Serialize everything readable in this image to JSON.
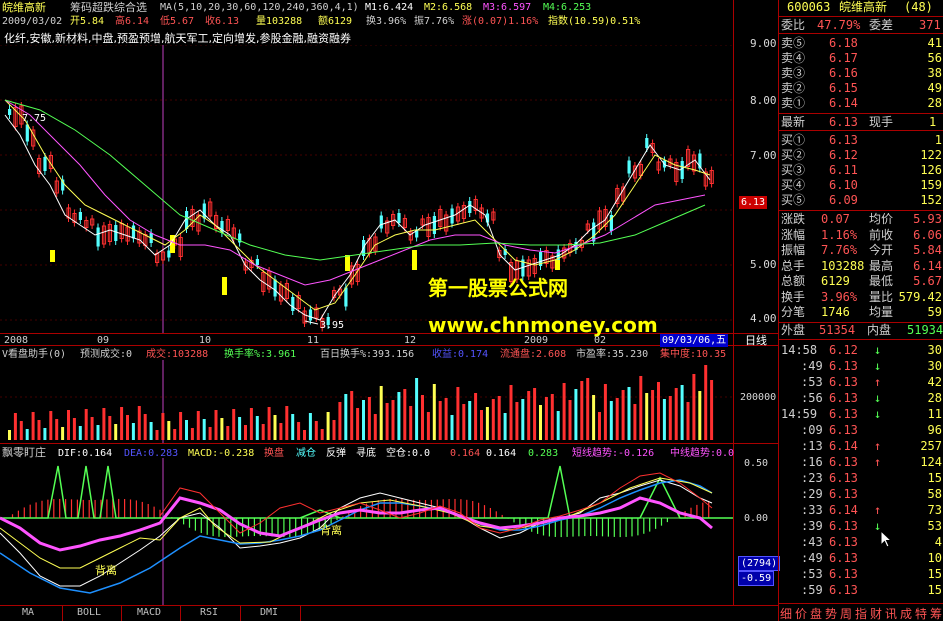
{
  "header": {
    "stock_name": "皖维高新",
    "indicator_title": "筹码超跌综合选",
    "ma_params": "MA(5,10,20,30,60,120,240,360,4,1)",
    "m1": "M1:6.424",
    "m2": "M2:6.568",
    "m3": "M3:6.597",
    "m4": "M4:6.253",
    "date": "2009/03/02",
    "open": "开5.84",
    "high": "高6.14",
    "low": "低5.67",
    "close": "收6.13",
    "volume": "量103288",
    "amount": "额6129",
    "turnover": "换3.96%",
    "amplitude": "振7.76%",
    "change": "涨(0.07)1.16%",
    "index": "指数(10.59)0.51%",
    "concepts": "化纤,安徽,新材料,中盘,预盈预增,航天军工,定向增发,参股金融,融资融券"
  },
  "watermark": {
    "line1": "第一股票公式网",
    "line2": "www.chnmoney.com"
  },
  "price_axis": [
    "9.00",
    "8.00",
    "7.00",
    "6.13",
    "5.00",
    "4.00"
  ],
  "chart_labels": {
    "peak": "7.75",
    "trough": "3.95"
  },
  "date_axis": [
    "2008",
    "09",
    "10",
    "11",
    "12",
    "2009",
    "02"
  ],
  "date_badge": "09/03/06,五",
  "period": "日线",
  "volume_panel": {
    "title": "V看盘助手(0)",
    "forecast": "预测成交:0",
    "volume": "成交:103288",
    "turnover": "换手率%:3.961",
    "hundred_turnover": "百日换手%:393.156",
    "profit": "收益:0.174",
    "circulation": "流通盘:2.608",
    "pe": "市盈率:35.230",
    "concentration": "集中度:10.35",
    "axis": "200000"
  },
  "macd_panel": {
    "title": "飘零盯庄",
    "dif": "DIF:0.164",
    "dea": "DEA:0.283",
    "macd": "MACD:-0.238",
    "swap": "换盘",
    "reduce": "减仓",
    "rebound": "反弹",
    "bottom": "寻底",
    "empty": "空仓:0.0",
    "v1": "0.164",
    "v2": "0.164",
    "v3": "0.283",
    "short_trend": "短线趋势:-0.126",
    "mid_trend": "中线趋势:0.0",
    "axis_top": "0.50",
    "axis_mid": "0.00",
    "axis_bot": "-0.50",
    "label1": "背离",
    "label2": "背离",
    "box1": "(2794)",
    "box2": "-0.59"
  },
  "bottom_tabs": [
    "MA",
    "BOLL",
    "MACD",
    "RSI",
    "DMI"
  ],
  "quote": {
    "code": "600063",
    "name": "皖维高新",
    "count": "(48)",
    "weibi_label": "委比",
    "weibi": "47.79%",
    "weicha_label": "委差",
    "weicha": "371",
    "asks": [
      {
        "label": "卖⑤",
        "price": "6.18",
        "vol": "41"
      },
      {
        "label": "卖④",
        "price": "6.17",
        "vol": "56"
      },
      {
        "label": "卖③",
        "price": "6.16",
        "vol": "38"
      },
      {
        "label": "卖②",
        "price": "6.15",
        "vol": "49"
      },
      {
        "label": "卖①",
        "price": "6.14",
        "vol": "28"
      }
    ],
    "last_label": "最新",
    "last": "6.13",
    "cur_label": "现手",
    "cur": "1",
    "bids": [
      {
        "label": "买①",
        "price": "6.13",
        "vol": "1"
      },
      {
        "label": "买②",
        "price": "6.12",
        "vol": "122"
      },
      {
        "label": "买③",
        "price": "6.11",
        "vol": "126"
      },
      {
        "label": "买④",
        "price": "6.10",
        "vol": "159"
      },
      {
        "label": "买⑤",
        "price": "6.09",
        "vol": "152"
      }
    ],
    "stats": [
      {
        "l1": "涨跌",
        "v1": "0.07",
        "l2": "均价",
        "v2": "5.93"
      },
      {
        "l1": "涨幅",
        "v1": "1.16%",
        "l2": "前收",
        "v2": "6.06"
      },
      {
        "l1": "振幅",
        "v1": "7.76%",
        "l2": "今开",
        "v2": "5.84"
      },
      {
        "l1": "总手",
        "v1": "103288",
        "l2": "最高",
        "v2": "6.14"
      },
      {
        "l1": "总额",
        "v1": "6129",
        "l2": "最低",
        "v2": "5.67"
      },
      {
        "l1": "换手",
        "v1": "3.96%",
        "l2": "量比",
        "v2": "579.42"
      },
      {
        "l1": "分笔",
        "v1": "1746",
        "l2": "均量",
        "v2": "59"
      }
    ],
    "outer_label": "外盘",
    "outer": "51354",
    "inner_label": "内盘",
    "inner": "51934",
    "ticks": [
      {
        "t": "14:58",
        "p": "6.12",
        "a": "↓",
        "v": "30"
      },
      {
        "t": ":49",
        "p": "6.13",
        "a": "↓",
        "v": "30"
      },
      {
        "t": ":53",
        "p": "6.13",
        "a": "↑",
        "v": "42"
      },
      {
        "t": ":56",
        "p": "6.13",
        "a": "↓",
        "v": "28"
      },
      {
        "t": "14:59",
        "p": "6.13",
        "a": "↓",
        "v": "11"
      },
      {
        "t": ":09",
        "p": "6.13",
        "a": "",
        "v": "96"
      },
      {
        "t": ":13",
        "p": "6.14",
        "a": "↑",
        "v": "257"
      },
      {
        "t": ":16",
        "p": "6.13",
        "a": "↑",
        "v": "124"
      },
      {
        "t": ":23",
        "p": "6.13",
        "a": "",
        "v": "15"
      },
      {
        "t": ":29",
        "p": "6.13",
        "a": "",
        "v": "58"
      },
      {
        "t": ":33",
        "p": "6.14",
        "a": "↑",
        "v": "73"
      },
      {
        "t": ":39",
        "p": "6.13",
        "a": "↓",
        "v": "53"
      },
      {
        "t": ":43",
        "p": "6.13",
        "a": "",
        "v": "4"
      },
      {
        "t": ":49",
        "p": "6.13",
        "a": "",
        "v": "10"
      },
      {
        "t": ":53",
        "p": "6.13",
        "a": "",
        "v": "15"
      },
      {
        "t": ":59",
        "p": "6.13",
        "a": "",
        "v": "15"
      }
    ],
    "bottom_tabs": [
      "细",
      "价",
      "盘",
      "势",
      "周",
      "指",
      "财",
      "讯",
      "成",
      "特",
      "筹"
    ]
  }
}
